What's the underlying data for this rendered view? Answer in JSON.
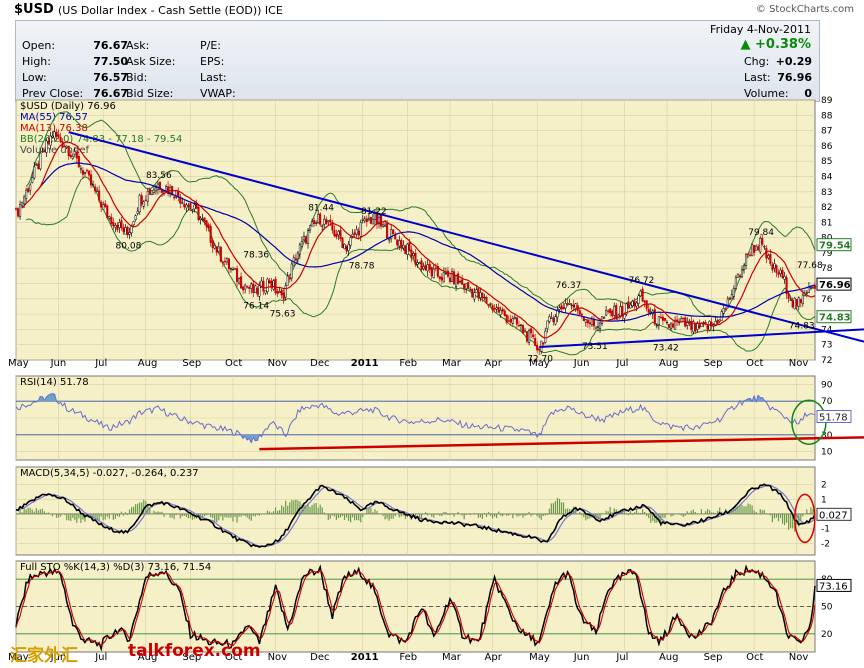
{
  "header": {
    "symbol": "$USD",
    "description": "(US Dollar Index - Cash Settle (EOD))",
    "exchange": "ICE",
    "brand": "© StockCharts.com"
  },
  "quote": {
    "date": "Friday  4-Nov-2011",
    "change_pct": "+0.38%",
    "rows": [
      {
        "label": "Open:",
        "value": "76.67",
        "label2": "Ask:",
        "label3": "P/E:",
        "label4": "Chg:",
        "value4": "+0.29"
      },
      {
        "label": "High:",
        "value": "77.50",
        "label2": "Ask Size:",
        "label3": "EPS:",
        "label4": "Last:",
        "value4": "76.96"
      },
      {
        "label": "Low:",
        "value": "76.57",
        "label2": "Bid:",
        "label3": "Last:",
        "label4": "Volume:",
        "value4": "0"
      },
      {
        "label": "Prev Close:",
        "value": "76.67",
        "label2": "Bid Size:",
        "label3": "VWAP:",
        "label4": "",
        "value4": ""
      }
    ]
  },
  "colors": {
    "panel_bg": "#f5f0c8",
    "ma55": "#0000aa",
    "ma13": "#cc0000",
    "bb": "#2a7a2a",
    "trend": "#0000cc",
    "rsi": "#6a6acc",
    "support": "#cc0000",
    "circle_green": "#118811",
    "circle_red": "#dd0000"
  },
  "chart_data": [
    {
      "type": "candlestick",
      "legend": [
        {
          "text": "$USD (Daily) 76.96",
          "color": "#000000"
        },
        {
          "text": "MA(55) 76.57",
          "color": "#0000aa"
        },
        {
          "text": "MA(13) 76.38",
          "color": "#cc0000"
        },
        {
          "text": "BB(26,2.0) 74.83 - 77.18 - 79.54",
          "color": "#2a7a2a"
        },
        {
          "text": "Volume undef",
          "color": "#444444"
        }
      ],
      "ylim": [
        72,
        89
      ],
      "yticks": [
        72,
        73,
        74,
        75,
        76,
        77,
        78,
        79,
        80,
        81,
        82,
        83,
        84,
        85,
        86,
        87,
        88,
        89
      ],
      "xticks": [
        "May",
        "Jun",
        "Jul",
        "Aug",
        "Sep",
        "Oct",
        "Nov",
        "Dec",
        "2011",
        "Feb",
        "Mar",
        "Apr",
        "May",
        "Jun",
        "Jul",
        "Aug",
        "Sep",
        "Oct",
        "Nov"
      ],
      "close_anchors": [
        [
          0,
          81.5
        ],
        [
          10,
          84.5
        ],
        [
          18,
          86.8
        ],
        [
          25,
          86.0
        ],
        [
          34,
          84.2
        ],
        [
          45,
          81.5
        ],
        [
          55,
          80.2
        ],
        [
          61,
          82.5
        ],
        [
          70,
          83.5
        ],
        [
          78,
          83.0
        ],
        [
          90,
          81.5
        ],
        [
          100,
          79.0
        ],
        [
          110,
          77.2
        ],
        [
          118,
          76.4
        ],
        [
          125,
          77.2
        ],
        [
          131,
          76.0
        ],
        [
          138,
          78.8
        ],
        [
          145,
          80.5
        ],
        [
          150,
          81.3
        ],
        [
          158,
          80.2
        ],
        [
          163,
          79.4
        ],
        [
          170,
          80.8
        ],
        [
          176,
          81.3
        ],
        [
          183,
          80.4
        ],
        [
          190,
          79.6
        ],
        [
          198,
          78.4
        ],
        [
          206,
          77.6
        ],
        [
          216,
          77.3
        ],
        [
          224,
          76.6
        ],
        [
          232,
          75.8
        ],
        [
          240,
          75.0
        ],
        [
          248,
          74.2
        ],
        [
          255,
          73.2
        ],
        [
          258,
          72.8
        ],
        [
          264,
          74.8
        ],
        [
          272,
          75.8
        ],
        [
          278,
          75.2
        ],
        [
          285,
          74.2
        ],
        [
          292,
          75.0
        ],
        [
          300,
          75.2
        ],
        [
          308,
          76.1
        ],
        [
          314,
          74.8
        ],
        [
          320,
          74.2
        ],
        [
          328,
          74.4
        ],
        [
          336,
          74.0
        ],
        [
          344,
          74.3
        ],
        [
          350,
          75.4
        ],
        [
          356,
          77.4
        ],
        [
          362,
          79.2
        ],
        [
          367,
          79.6
        ],
        [
          372,
          78.2
        ],
        [
          378,
          77.4
        ],
        [
          383,
          75.8
        ],
        [
          387,
          75.6
        ],
        [
          391,
          77.0
        ],
        [
          394,
          76.96
        ]
      ],
      "labels": [
        {
          "i": 70,
          "v": 83.56,
          "text": "83.56",
          "pos": "above"
        },
        {
          "i": 55,
          "v": 80.08,
          "text": "80.08",
          "pos": "below"
        },
        {
          "i": 118,
          "v": 78.36,
          "text": "78.36",
          "pos": "above"
        },
        {
          "i": 118,
          "v": 76.14,
          "text": "76.14",
          "pos": "below"
        },
        {
          "i": 131,
          "v": 75.63,
          "text": "75.63",
          "pos": "below"
        },
        {
          "i": 150,
          "v": 81.44,
          "text": "81.44",
          "pos": "above"
        },
        {
          "i": 176,
          "v": 81.22,
          "text": "81.22",
          "pos": "above"
        },
        {
          "i": 170,
          "v": 78.78,
          "text": "78.78",
          "pos": "below"
        },
        {
          "i": 272,
          "v": 76.37,
          "text": "76.37",
          "pos": "above"
        },
        {
          "i": 258,
          "v": 72.7,
          "text": "72.70",
          "pos": "below"
        },
        {
          "i": 285,
          "v": 73.51,
          "text": "73.51",
          "pos": "below"
        },
        {
          "i": 308,
          "v": 76.72,
          "text": "76.72",
          "pos": "above"
        },
        {
          "i": 320,
          "v": 73.42,
          "text": "73.42",
          "pos": "below"
        },
        {
          "i": 367,
          "v": 79.84,
          "text": "79.84",
          "pos": "above"
        },
        {
          "i": 391,
          "v": 77.68,
          "text": "77.68",
          "pos": "above"
        },
        {
          "i": 387,
          "v": 74.83,
          "text": "74.83",
          "pos": "below"
        }
      ],
      "right_tags": [
        {
          "v": 79.54,
          "text": "79.54",
          "color": "#2a7a2a"
        },
        {
          "v": 76.96,
          "text": "76.96",
          "color": "#000000"
        },
        {
          "v": 74.83,
          "text": "74.83",
          "color": "#2a7a2a"
        }
      ],
      "trendlines": [
        {
          "from": [
            26,
            86.9
          ],
          "to": [
            420,
            73.2
          ],
          "color": "#0000cc"
        },
        {
          "from": [
            258,
            72.85
          ],
          "to": [
            420,
            74.0
          ],
          "color": "#0000cc"
        }
      ]
    },
    {
      "type": "line",
      "legend": [
        {
          "text": "RSI(14) 51.78",
          "color": "#000000"
        }
      ],
      "ylim": [
        0,
        100
      ],
      "yticks": [
        10,
        30,
        50,
        70,
        90
      ],
      "hlines": [
        30,
        70
      ],
      "last_tag": "51.78",
      "anchors": [
        [
          0,
          62
        ],
        [
          12,
          72
        ],
        [
          18,
          77
        ],
        [
          26,
          60
        ],
        [
          34,
          52
        ],
        [
          45,
          38
        ],
        [
          55,
          45
        ],
        [
          61,
          56
        ],
        [
          70,
          61
        ],
        [
          80,
          50
        ],
        [
          95,
          40
        ],
        [
          108,
          33
        ],
        [
          118,
          22
        ],
        [
          126,
          45
        ],
        [
          133,
          30
        ],
        [
          140,
          60
        ],
        [
          150,
          66
        ],
        [
          158,
          55
        ],
        [
          170,
          58
        ],
        [
          176,
          60
        ],
        [
          186,
          49
        ],
        [
          196,
          45
        ],
        [
          210,
          48
        ],
        [
          224,
          40
        ],
        [
          238,
          38
        ],
        [
          250,
          35
        ],
        [
          258,
          28
        ],
        [
          264,
          55
        ],
        [
          272,
          63
        ],
        [
          280,
          53
        ],
        [
          290,
          48
        ],
        [
          300,
          58
        ],
        [
          308,
          63
        ],
        [
          315,
          48
        ],
        [
          322,
          40
        ],
        [
          336,
          38
        ],
        [
          348,
          50
        ],
        [
          356,
          68
        ],
        [
          366,
          74
        ],
        [
          372,
          63
        ],
        [
          380,
          50
        ],
        [
          386,
          42
        ],
        [
          390,
          56
        ],
        [
          394,
          51.78
        ]
      ],
      "support": {
        "from": [
          120,
          13
        ],
        "to": [
          420,
          27
        ],
        "color": "#cc0000"
      }
    },
    {
      "type": "line",
      "legend": [
        {
          "text": "MACD(5,34,5) -0.027, -0.264, 0.237",
          "color": "#000000"
        }
      ],
      "ylim": [
        -2.8,
        3.2
      ],
      "yticks": [
        -2,
        -1,
        0,
        1,
        2
      ],
      "last_tag": "0.027",
      "anchors": [
        [
          0,
          0.2
        ],
        [
          14,
          1.4
        ],
        [
          24,
          1.0
        ],
        [
          34,
          -0.1
        ],
        [
          45,
          -1.0
        ],
        [
          55,
          -1.3
        ],
        [
          64,
          0.5
        ],
        [
          72,
          0.8
        ],
        [
          82,
          0.3
        ],
        [
          96,
          -0.6
        ],
        [
          110,
          -1.8
        ],
        [
          120,
          -2.3
        ],
        [
          130,
          -1.8
        ],
        [
          140,
          0.3
        ],
        [
          150,
          1.9
        ],
        [
          160,
          1.3
        ],
        [
          170,
          0.3
        ],
        [
          178,
          0.8
        ],
        [
          188,
          0.2
        ],
        [
          200,
          -0.4
        ],
        [
          214,
          -0.6
        ],
        [
          226,
          -0.8
        ],
        [
          240,
          -1.2
        ],
        [
          254,
          -1.6
        ],
        [
          262,
          -2.0
        ],
        [
          268,
          -0.4
        ],
        [
          276,
          0.4
        ],
        [
          288,
          -0.4
        ],
        [
          300,
          0.2
        ],
        [
          310,
          0.6
        ],
        [
          318,
          -0.6
        ],
        [
          328,
          -0.8
        ],
        [
          340,
          -0.4
        ],
        [
          352,
          0.2
        ],
        [
          362,
          1.6
        ],
        [
          370,
          2.0
        ],
        [
          378,
          1.2
        ],
        [
          386,
          -0.8
        ],
        [
          391,
          -0.5
        ],
        [
          394,
          -0.027
        ]
      ]
    },
    {
      "type": "line",
      "legend": [
        {
          "text": "Full STO %K(14,3) %D(3) 73.16, 71.54",
          "color": "#000000"
        }
      ],
      "ylim": [
        0,
        100
      ],
      "yticks": [
        20,
        50,
        80
      ],
      "hlines": [
        20,
        50,
        80
      ],
      "last_tag": "73.16",
      "anchors": [
        [
          0,
          30
        ],
        [
          6,
          80
        ],
        [
          14,
          88
        ],
        [
          22,
          86
        ],
        [
          28,
          30
        ],
        [
          34,
          12
        ],
        [
          42,
          8
        ],
        [
          50,
          25
        ],
        [
          56,
          15
        ],
        [
          64,
          82
        ],
        [
          72,
          90
        ],
        [
          80,
          70
        ],
        [
          86,
          20
        ],
        [
          96,
          10
        ],
        [
          108,
          8
        ],
        [
          114,
          30
        ],
        [
          120,
          10
        ],
        [
          128,
          70
        ],
        [
          134,
          25
        ],
        [
          142,
          85
        ],
        [
          150,
          90
        ],
        [
          156,
          40
        ],
        [
          162,
          82
        ],
        [
          170,
          88
        ],
        [
          176,
          70
        ],
        [
          184,
          20
        ],
        [
          192,
          10
        ],
        [
          200,
          50
        ],
        [
          206,
          15
        ],
        [
          214,
          60
        ],
        [
          220,
          20
        ],
        [
          228,
          10
        ],
        [
          236,
          80
        ],
        [
          244,
          40
        ],
        [
          250,
          20
        ],
        [
          258,
          10
        ],
        [
          266,
          75
        ],
        [
          272,
          88
        ],
        [
          278,
          40
        ],
        [
          286,
          20
        ],
        [
          292,
          70
        ],
        [
          300,
          85
        ],
        [
          306,
          88
        ],
        [
          312,
          20
        ],
        [
          318,
          12
        ],
        [
          326,
          40
        ],
        [
          334,
          15
        ],
        [
          342,
          30
        ],
        [
          350,
          70
        ],
        [
          356,
          88
        ],
        [
          362,
          90
        ],
        [
          368,
          85
        ],
        [
          374,
          70
        ],
        [
          380,
          20
        ],
        [
          386,
          8
        ],
        [
          392,
          30
        ],
        [
          394,
          73.16
        ]
      ]
    }
  ],
  "watermark": {
    "cn": "汇家外汇",
    "en": "talkforex.com"
  }
}
